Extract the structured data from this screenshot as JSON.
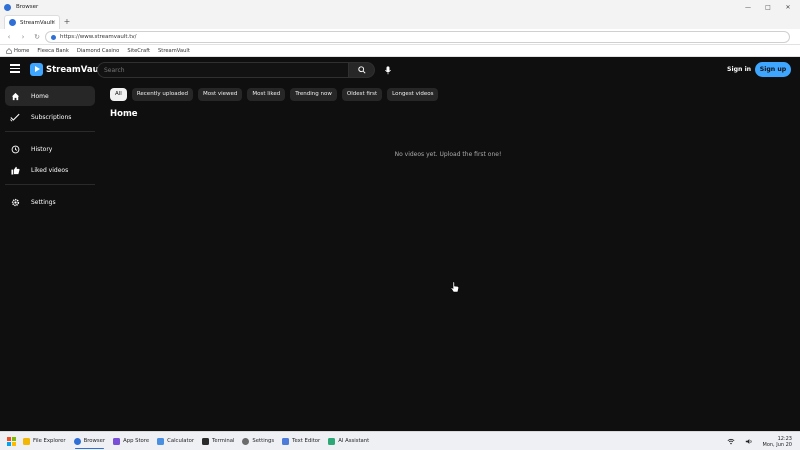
{
  "window": {
    "title": "Browser"
  },
  "tab": {
    "label": "StreamVault",
    "close": "×",
    "new": "+"
  },
  "address": {
    "url": "https://www.streamvault.tv/"
  },
  "bookmarks": [
    "Home",
    "Fleeca Bank",
    "Diamond Casino",
    "SiteCraft",
    "StreamVault"
  ],
  "site": {
    "logo": "StreamVault",
    "search_placeholder": "Search",
    "signin": "Sign in",
    "signup": "Sign up",
    "sidebar": [
      {
        "label": "Home",
        "icon": "home-icon"
      },
      {
        "label": "Subscriptions",
        "icon": "subscriptions-icon"
      },
      {
        "label": "History",
        "icon": "history-icon"
      },
      {
        "label": "Liked videos",
        "icon": "thumbs-up-icon"
      },
      {
        "label": "Settings",
        "icon": "gear-icon"
      }
    ],
    "chips": [
      "All",
      "Recently uploaded",
      "Most viewed",
      "Most liked",
      "Trending now",
      "Oldest first",
      "Longest videos"
    ],
    "page_title": "Home",
    "empty_message": "No videos yet. Upload the first one!"
  },
  "taskbar": {
    "apps": [
      {
        "label": "File Explorer",
        "color": "#f2b705"
      },
      {
        "label": "Browser",
        "color": "#2f6fd6"
      },
      {
        "label": "App Store",
        "color": "#7a4fd8"
      },
      {
        "label": "Calculator",
        "color": "#4a8fe0"
      },
      {
        "label": "Terminal",
        "color": "#2b2b2b"
      },
      {
        "label": "Settings",
        "color": "#6b6b6b"
      },
      {
        "label": "Text Editor",
        "color": "#4c7bd9"
      },
      {
        "label": "AI Assistant",
        "color": "#2da876"
      }
    ],
    "time": "12:23",
    "date": "Mon, Jun 20"
  },
  "colors": {
    "accent": "#3ea6ff",
    "site_bg": "#0f0f0f",
    "chip_bg": "#272727"
  }
}
